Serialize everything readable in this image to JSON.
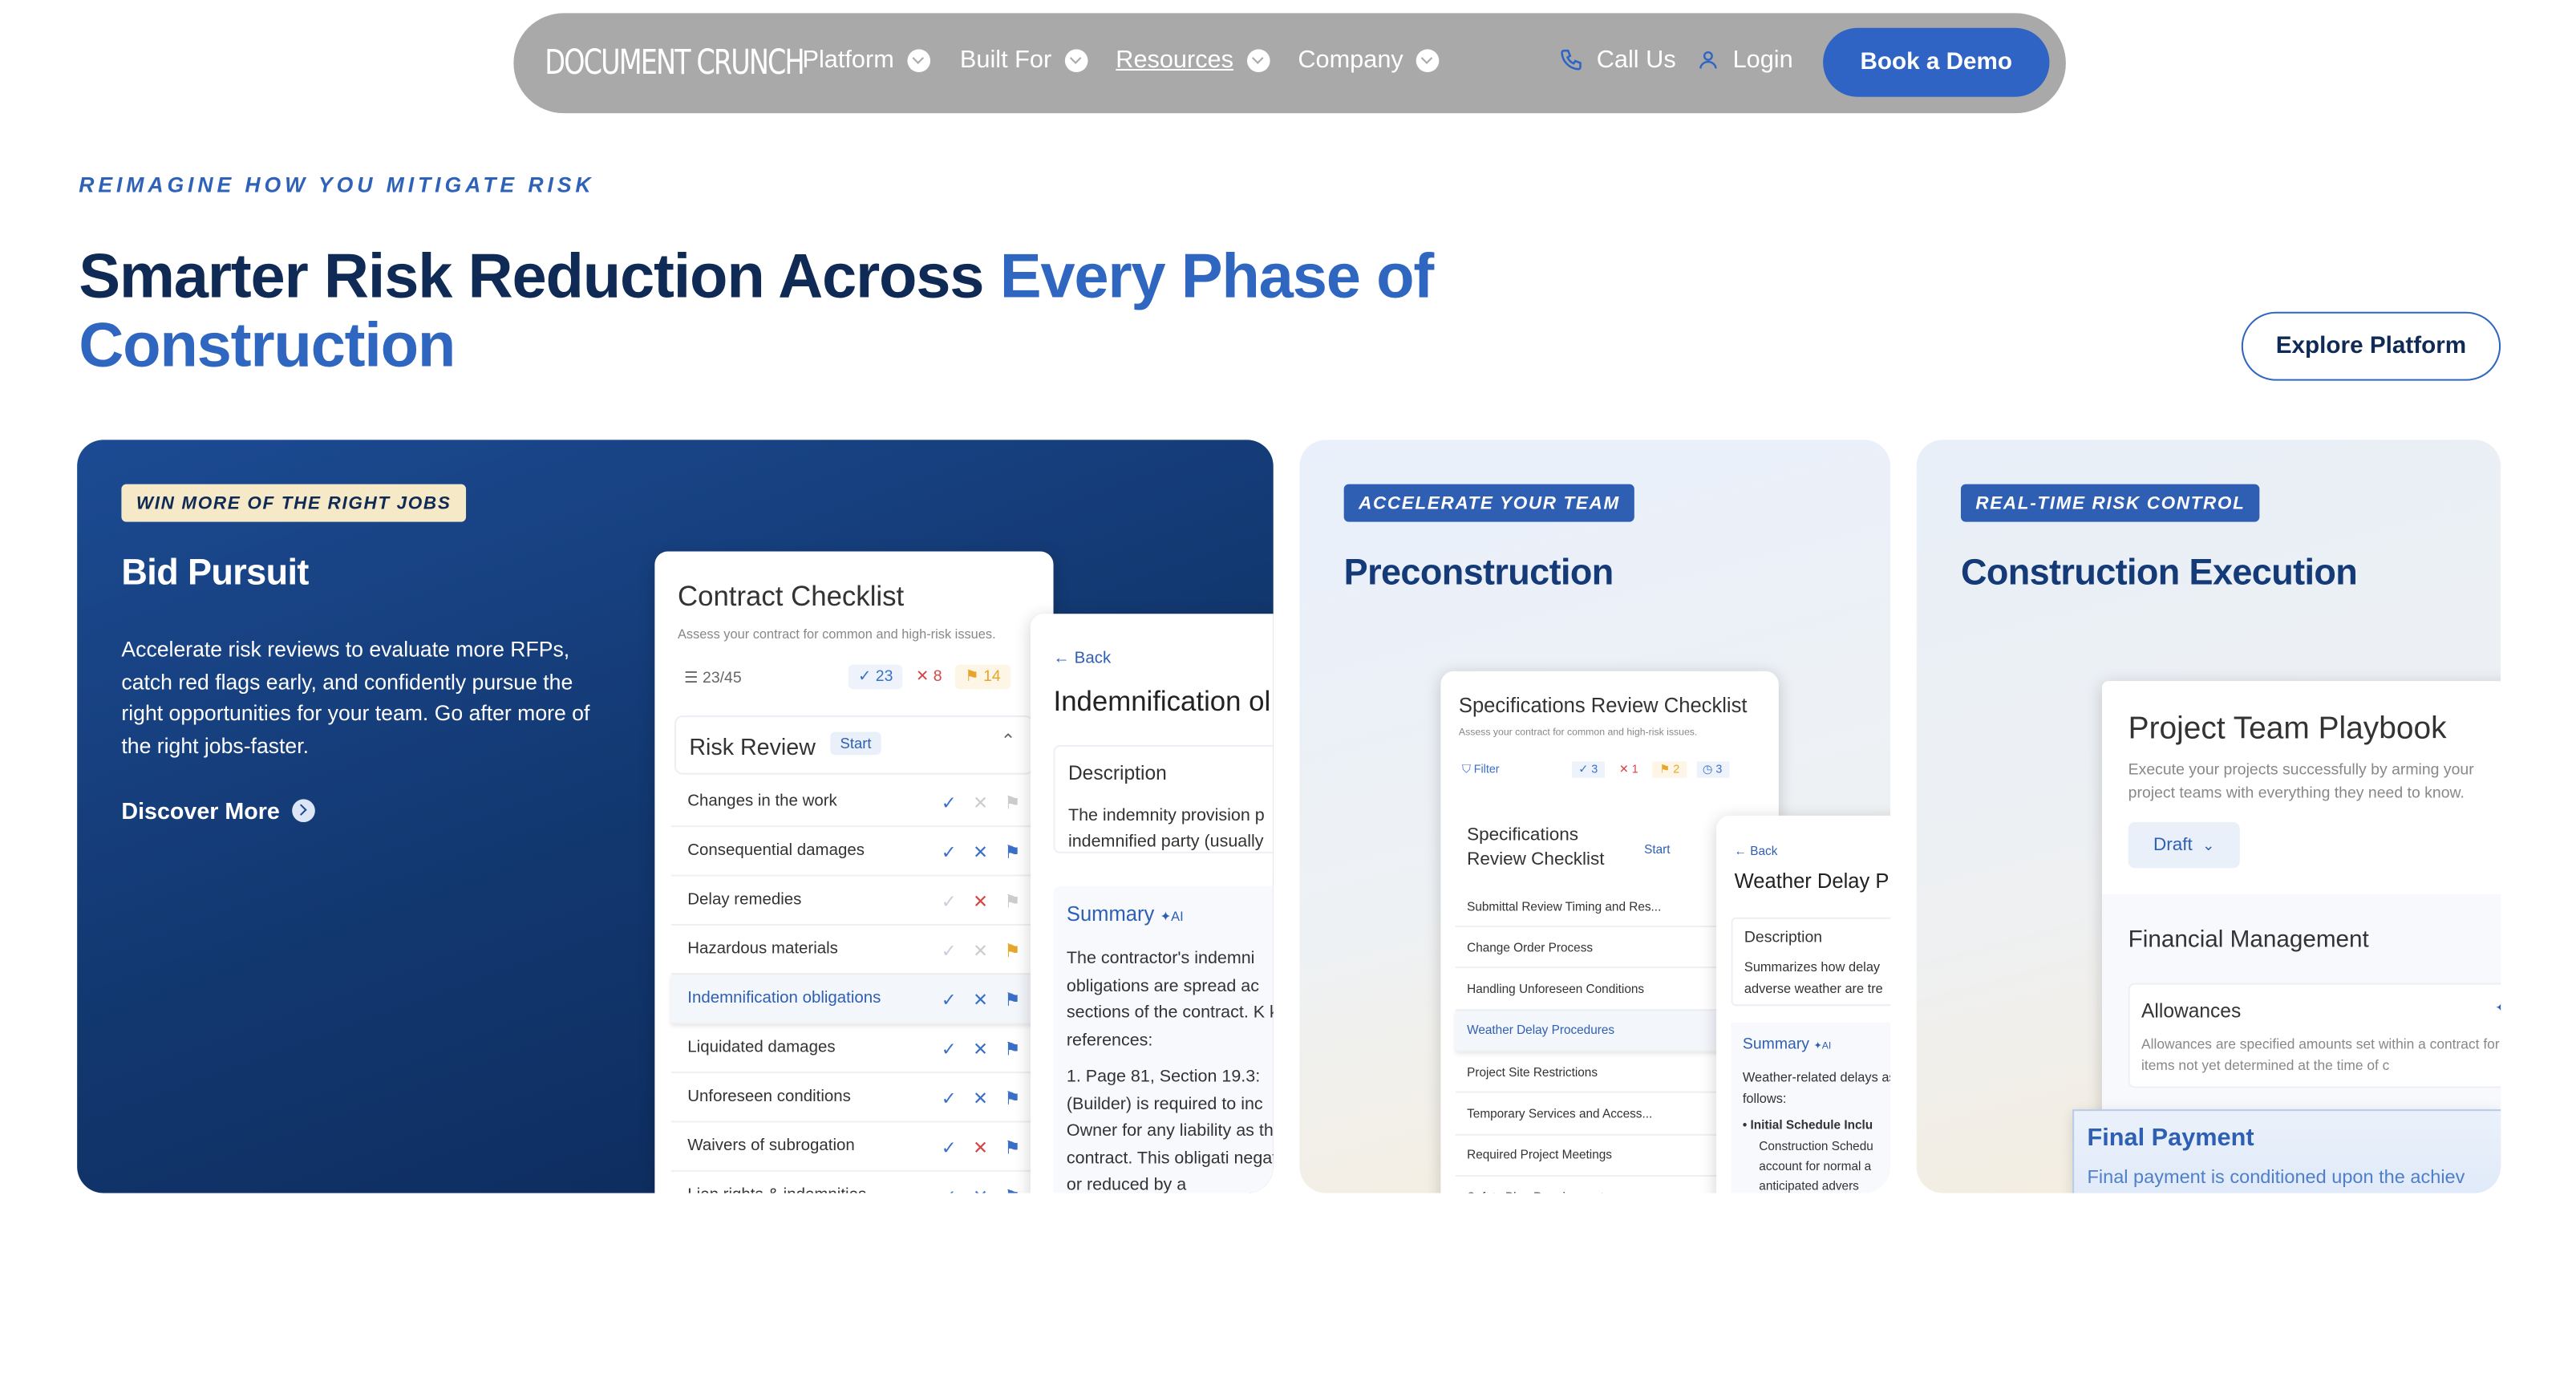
{
  "nav": {
    "logo": "DOCUMENT CRUNCH",
    "items": [
      {
        "label": "Platform"
      },
      {
        "label": "Built For"
      },
      {
        "label": "Resources"
      },
      {
        "label": "Company"
      }
    ],
    "call": "Call Us",
    "login": "Login",
    "demo": "Book a Demo"
  },
  "hero": {
    "eyebrow": "REIMAGINE HOW YOU MITIGATE RISK",
    "title_a": "Smarter Risk Reduction Across ",
    "title_b": "Every Phase of Construction",
    "cta": "Explore Platform"
  },
  "cards": [
    {
      "badge": "WIN MORE OF THE RIGHT JOBS",
      "title": "Bid Pursuit",
      "desc": "Accelerate risk reviews to evaluate more RFPs, catch red flags early, and confidently pursue the right opportunities for your team. Go after more of the right jobs-faster.",
      "link": "Discover More",
      "mock": {
        "title": "Contract Checklist",
        "sub": "Assess your contract for common and high-risk issues.",
        "count": "23/45",
        "ok": "23",
        "bad": "8",
        "flag": "14",
        "section": "Risk Review",
        "start": "Start",
        "rows": [
          "Changes in the work",
          "Consequential damages",
          "Delay remedies",
          "Hazardous materials",
          "Indemnification obligations",
          "Liquidated damages",
          "Unforeseen conditions",
          "Waivers of subrogation",
          "Lien rights & indemnities"
        ],
        "detail": {
          "back": "Back",
          "title": "Indemnification ol",
          "desc_h": "Description",
          "desc": "The indemnity provision p indemnified party (usually",
          "sum_h": "Summary",
          "ai": "AI",
          "sum": "The contractor's indemni obligations are spread ac sections of the contract. K key references:",
          "ref_link": "Page 81",
          "ref": "1. Page 81, Section 19.3: (Builder) is required to inc Owner for any liability as the contract. This obligati negated or reduced by a"
        }
      }
    },
    {
      "badge": "ACCELERATE YOUR TEAM",
      "title": "Preconstruction",
      "mock": {
        "title": "Specifications Review Checklist",
        "sub": "Assess your contract for common and high-risk issues.",
        "filter": "Filter",
        "ok": "3",
        "bad": "1",
        "flag": "2",
        "info": "3",
        "section": "Specifications Review Checklist",
        "start": "Start",
        "rows": [
          "Submittal Review Timing and Res...",
          "Change Order Process",
          "Handling Unforeseen Conditions",
          "Weather Delay Procedures",
          "Project Site Restrictions",
          "Temporary Services and Access...",
          "Required Project Meetings",
          "Safety Plan Requirements"
        ],
        "detail": {
          "back": "Back",
          "title": "Weather Delay P",
          "desc_h": "Description",
          "desc": "Summarizes how delay adverse weather are tre",
          "sum_h": "Summary",
          "ai": "AI",
          "sum": "Weather-related delays as follows:",
          "bullet_b": "Initial Schedule Inclu",
          "bullet": "Construction Schedu account for normal a anticipated advers"
        }
      }
    },
    {
      "badge": "REAL-TIME RISK CONTROL",
      "title": "Construction Execution",
      "mock": {
        "title": "Project Team Playbook",
        "sub": "Execute your projects successfully by arming your project teams with everything they need to know.",
        "draft": "Draft",
        "section": "Financial Management",
        "allow_h": "Allowances",
        "allow": "Allowances are specified amounts set within a contract for items not yet determined at the time of c",
        "final_h": "Final Payment",
        "final": "Final payment is conditioned upon the achiev"
      }
    }
  ],
  "colors": {
    "brand": "#2f64c4",
    "navy": "#0f2a55",
    "accent": "#2f66c0"
  }
}
